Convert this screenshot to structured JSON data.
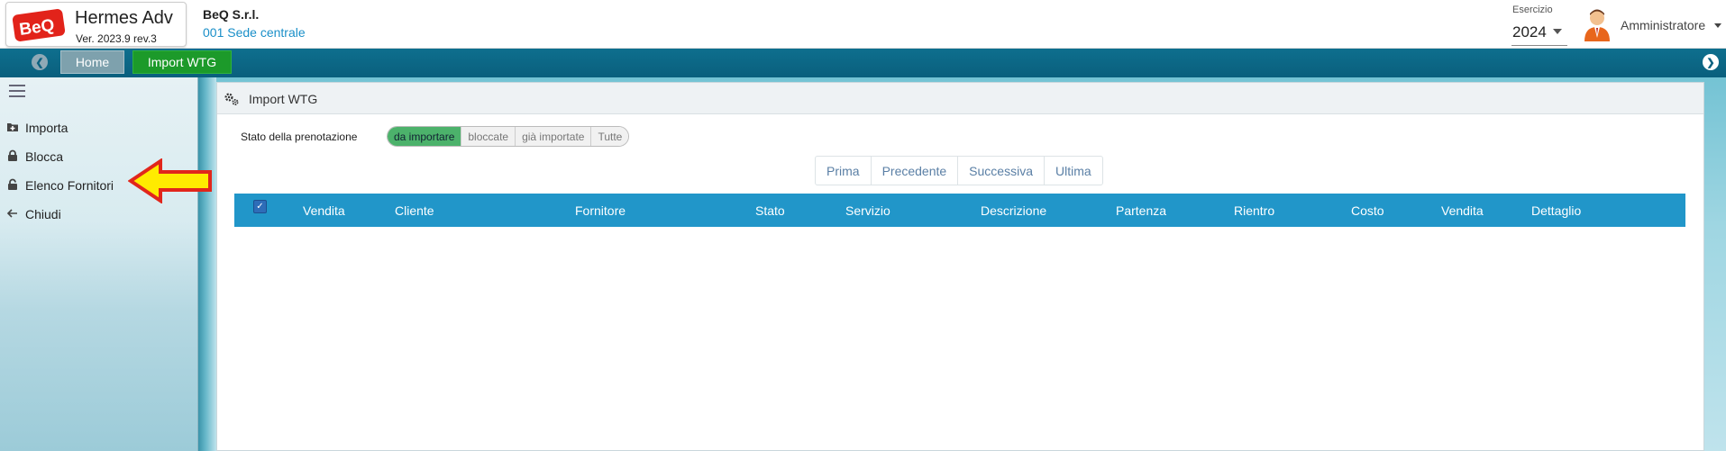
{
  "app": {
    "name": "Hermes Adv",
    "version": "Ver. 2023.9 rev.3",
    "logo_text": "BeQ",
    "brand_color": "#e2231a"
  },
  "company": {
    "name": "BeQ S.r.l.",
    "site": "001 Sede centrale"
  },
  "esercizio": {
    "label": "Esercizio",
    "value": "2024"
  },
  "user": {
    "name": "Amministratore"
  },
  "tabs": [
    {
      "label": "Home",
      "active": false
    },
    {
      "label": "Import WTG",
      "active": true
    }
  ],
  "sidebar": {
    "items": [
      {
        "label": "Importa",
        "icon": "folder-plus-icon"
      },
      {
        "label": "Blocca",
        "icon": "lock-icon"
      },
      {
        "label": "Elenco Fornitori",
        "icon": "unlock-icon"
      },
      {
        "label": "Chiudi",
        "icon": "arrow-left-icon"
      }
    ]
  },
  "panel": {
    "title": "Import WTG",
    "filter_label": "Stato della prenotazione",
    "filters": [
      "da importare",
      "bloccate",
      "già importate",
      "Tutte"
    ],
    "active_filter": "da importare"
  },
  "pager": [
    "Prima",
    "Precedente",
    "Successiva",
    "Ultima"
  ],
  "table": {
    "columns": [
      "Vendita",
      "Cliente",
      "Fornitore",
      "Stato",
      "Servizio",
      "Descrizione",
      "Partenza",
      "Rientro",
      "Costo",
      "Vendita",
      "Dettaglio"
    ],
    "select_all_checked": true,
    "rows": []
  },
  "colors": {
    "tabbar": "#0a6788",
    "active_tab": "#1c9a2a",
    "table_header": "#2196c9",
    "active_filter": "#4cb26b"
  }
}
